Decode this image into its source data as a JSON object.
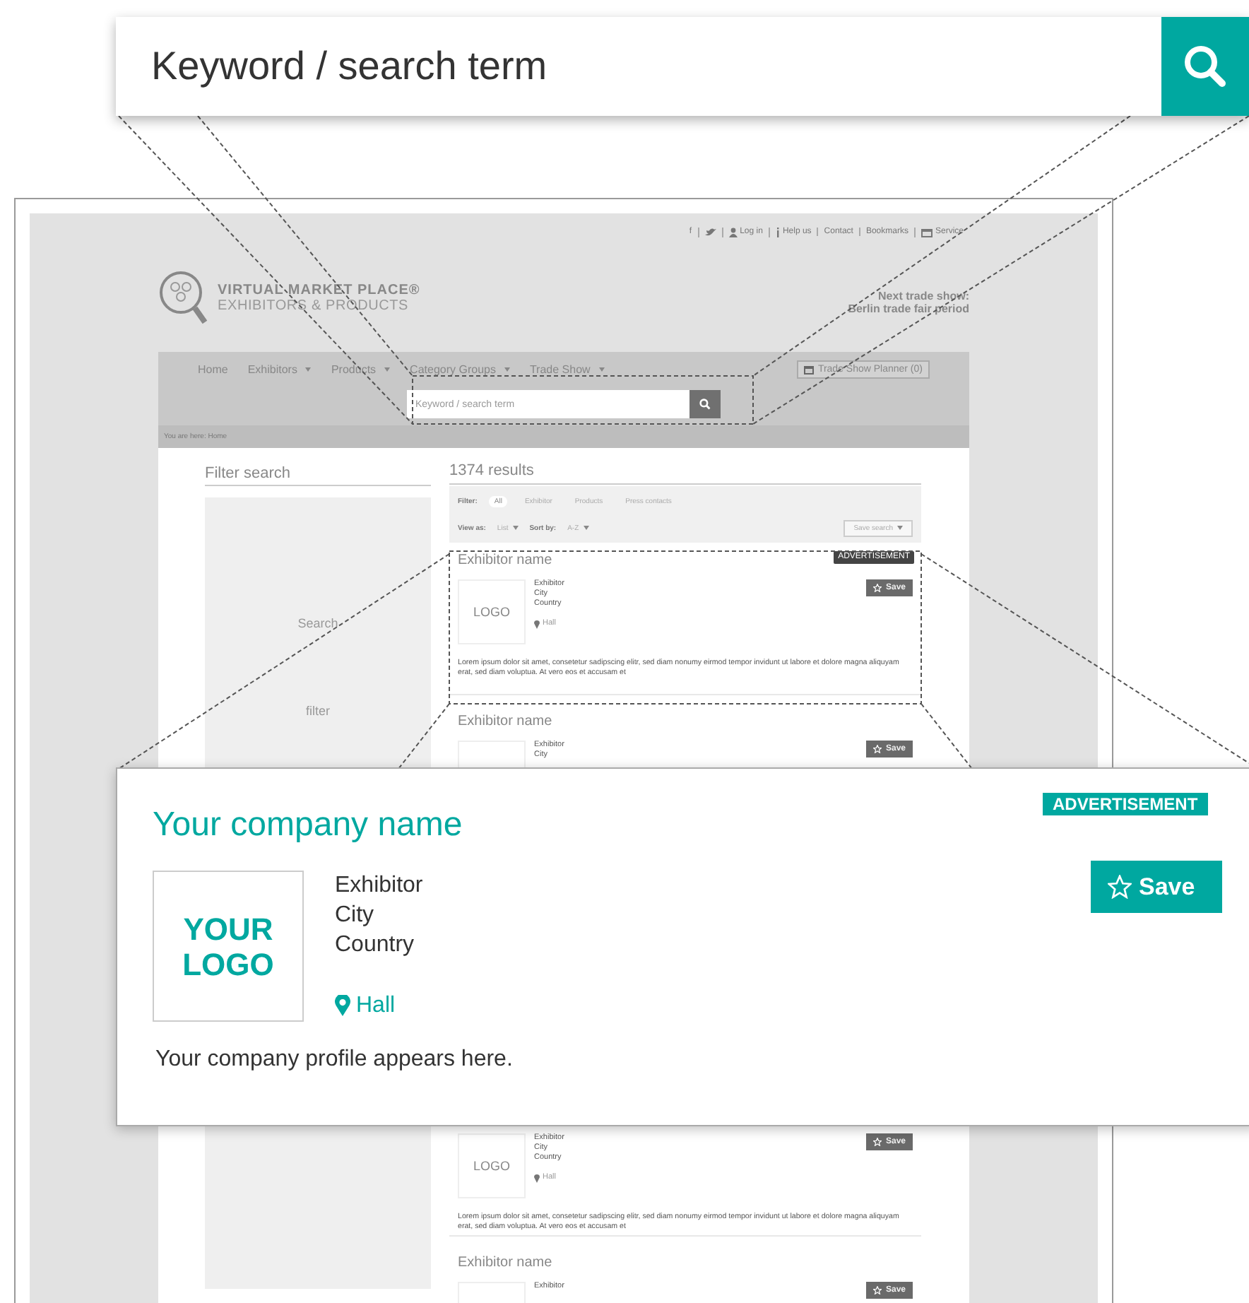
{
  "search_callout": {
    "placeholder": "Keyword / search term"
  },
  "website": {
    "top_links": [
      {
        "kind": "text",
        "label": "f"
      },
      {
        "kind": "bird"
      },
      {
        "kind": "person",
        "label": "Log in"
      },
      {
        "kind": "question",
        "label": "Help us"
      },
      {
        "kind": "text",
        "label": "Contact"
      },
      {
        "kind": "text",
        "label": "Bookmarks"
      },
      {
        "kind": "calendar",
        "label": "Service"
      }
    ],
    "brand": {
      "title": "VIRTUAL MARKET PLACE®",
      "subtitle": "EXHIBITORS & PRODUCTS"
    },
    "next_show": {
      "label": "Next trade show:",
      "value": "Berlin trade fair period"
    },
    "nav": [
      {
        "label": "Home",
        "dropdown": false
      },
      {
        "label": "Exhibitors",
        "dropdown": true
      },
      {
        "label": "Products",
        "dropdown": true
      },
      {
        "label": "Category Groups",
        "dropdown": true
      },
      {
        "label": "Trade Show",
        "dropdown": true
      }
    ],
    "planner_button": "Trade Show Planner (0)",
    "search": {
      "placeholder": "Keyword / search term"
    },
    "breadcrumb": "You are here: Home",
    "filter_panel": {
      "title": "Filter search",
      "texts": [
        "Search",
        "filter"
      ]
    },
    "results": {
      "count": "1374 results",
      "filter_label": "Filter:",
      "filter_tabs": [
        {
          "label": "All",
          "selected": true
        },
        {
          "label": "Exhibitor",
          "selected": false
        },
        {
          "label": "Products",
          "selected": false
        },
        {
          "label": "Press contacts",
          "selected": false
        }
      ],
      "view_label": "View as:",
      "view_value": "List",
      "sort_label": "Sort by:",
      "sort_value": "A-Z",
      "save_search": "Save search",
      "items": [
        {
          "advertisement": "ADVERTISEMENT",
          "name": "Exhibitor name",
          "logo": "LOGO",
          "address": [
            "Exhibitor",
            "City",
            "Country"
          ],
          "hall": "Hall",
          "save": "Save",
          "text": "Lorem ipsum dolor sit amet, consetetur sadipscing elitr, sed diam nonumy eirmod tempor invidunt ut labore et dolore magna aliquyam erat, sed diam voluptua. At vero eos et accusam et"
        },
        {
          "name": "Exhibitor name",
          "address": [
            "Exhibitor",
            "City"
          ],
          "save": "Save"
        },
        {
          "logo": "LOGO",
          "address": [
            "Exhibitor",
            "City",
            "Country"
          ],
          "hall": "Hall",
          "save": "Save",
          "text": "Lorem ipsum dolor sit amet, consetetur sadipscing elitr, sed diam nonumy eirmod tempor invidunt ut labore et dolore magna aliquyam erat, sed diam voluptua. At vero eos et accusam et"
        },
        {
          "name": "Exhibitor name",
          "address": [
            "Exhibitor"
          ],
          "save": "Save"
        }
      ]
    }
  },
  "ad_callout": {
    "company": "Your company name",
    "badge": "ADVERTISEMENT",
    "logo": "YOUR LOGO",
    "address": [
      "Exhibitor",
      "City",
      "Country"
    ],
    "hall": "Hall",
    "save": "Save",
    "profile": "Your company profile appears here."
  }
}
